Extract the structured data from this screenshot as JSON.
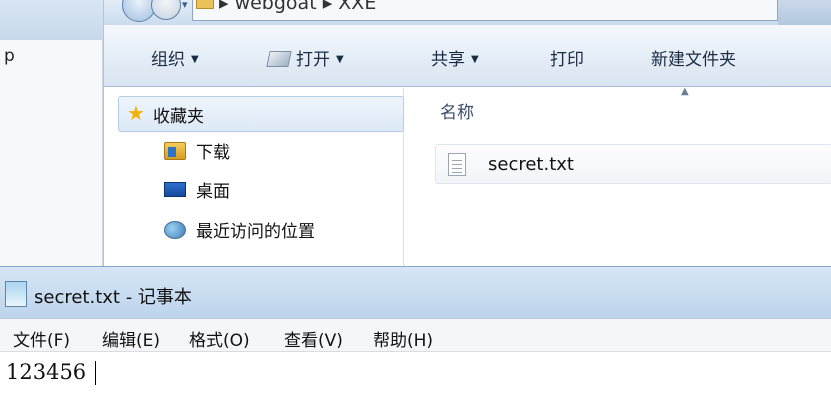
{
  "background_window": {
    "fragment_text": "p"
  },
  "explorer": {
    "breadcrumb": [
      "webgoat",
      "XXE"
    ],
    "toolbar": {
      "organize": "组织",
      "open": "打开",
      "share": "共享",
      "print": "打印",
      "new_folder": "新建文件夹"
    },
    "nav_pane": {
      "favorites": "收藏夹",
      "items": [
        "下载",
        "桌面",
        "最近访问的位置"
      ]
    },
    "column_header": "名称",
    "files": [
      {
        "name": "secret.txt",
        "icon": "text-file-icon"
      }
    ]
  },
  "notepad": {
    "title": "secret.txt - 记事本",
    "menu": [
      "文件(F)",
      "编辑(E)",
      "格式(O)",
      "查看(V)",
      "帮助(H)"
    ],
    "content": "123456"
  }
}
